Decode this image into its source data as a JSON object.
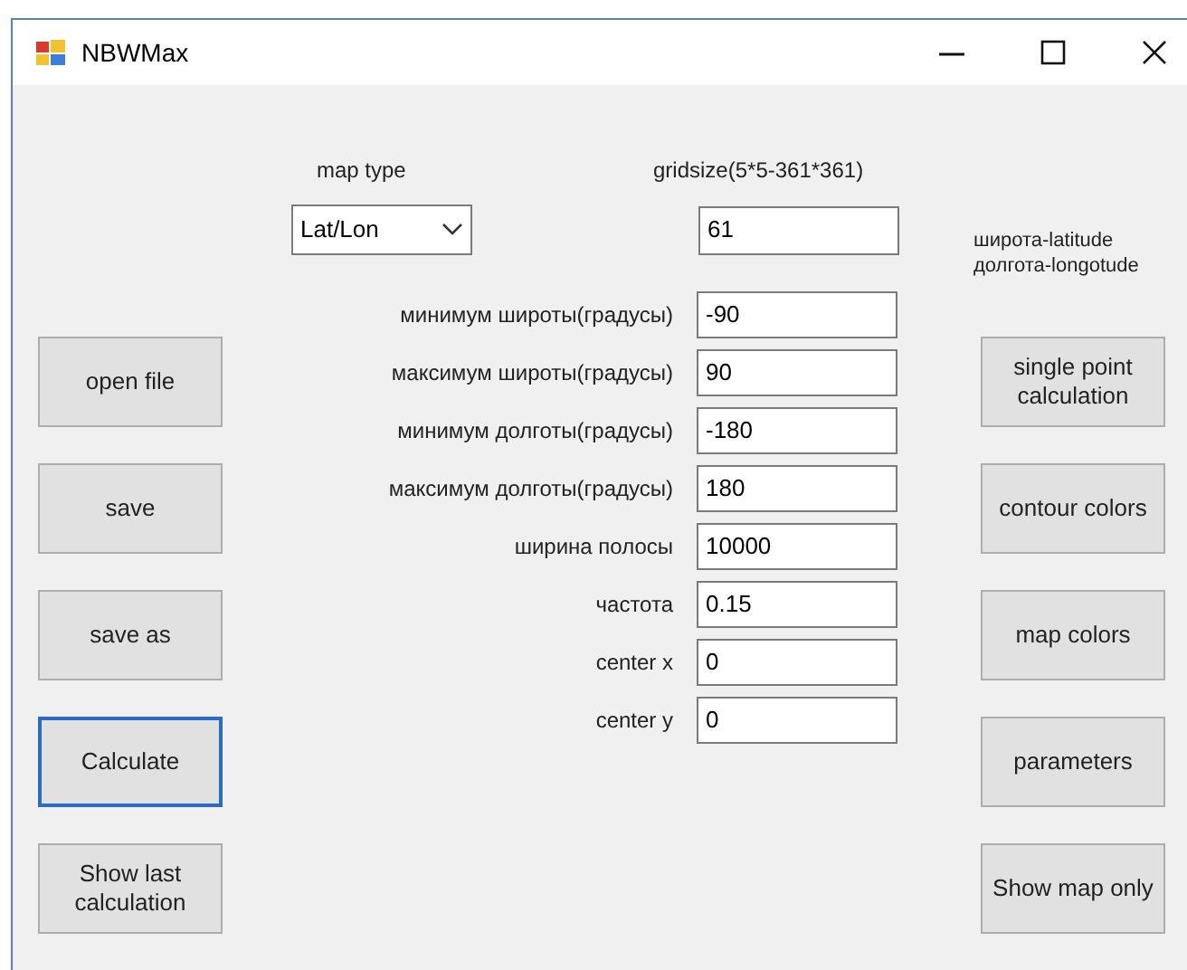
{
  "window": {
    "title": "NBWMax"
  },
  "map_type": {
    "label": "map type",
    "value": "Lat/Lon"
  },
  "gridsize": {
    "label": "gridsize(5*5-361*361)",
    "value": "61"
  },
  "legend": [
    "широта-latitude",
    "долгота-longotude"
  ],
  "fields": [
    {
      "label": "минимум широты(градусы)",
      "value": "-90"
    },
    {
      "label": "максимум широты(градусы)",
      "value": "90"
    },
    {
      "label": "минимум долготы(градусы)",
      "value": "-180"
    },
    {
      "label": "максимум долготы(градусы)",
      "value": "180"
    },
    {
      "label": "ширина полосы",
      "value": "10000"
    },
    {
      "label": "частота",
      "value": "0.15"
    },
    {
      "label": "center x",
      "value": "0"
    },
    {
      "label": "center y",
      "value": "0"
    }
  ],
  "left_buttons": [
    {
      "label": "open file",
      "focused": false
    },
    {
      "label": "save",
      "focused": false
    },
    {
      "label": "save as",
      "focused": false
    },
    {
      "label": "Calculate",
      "focused": true
    },
    {
      "label": "Show last calculation",
      "focused": false
    }
  ],
  "right_buttons": [
    {
      "label": "single point calculation",
      "focused": false
    },
    {
      "label": "contour colors",
      "focused": false
    },
    {
      "label": "map colors",
      "focused": false
    },
    {
      "label": "parameters",
      "focused": false
    },
    {
      "label": "Show map only",
      "focused": false
    }
  ]
}
